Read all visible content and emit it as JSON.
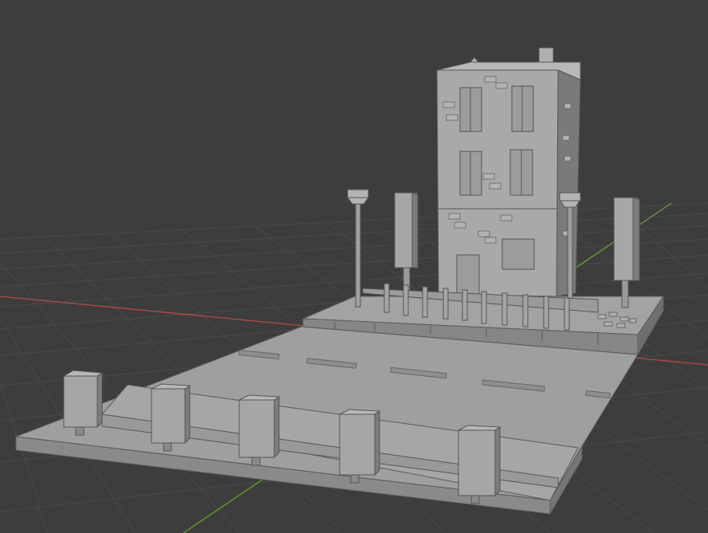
{
  "viewport": {
    "background": "#3d3d3d",
    "grid_color": "#4a4a4a",
    "axis_x_color": "#b34a4a",
    "axis_y_color": "#6f9a3a"
  },
  "scene": {
    "object_color": "#9a9a9a",
    "light_face": "#a8a8a8",
    "dark_face": "#7e7e7e",
    "edge_color": "#5a5a5a"
  }
}
